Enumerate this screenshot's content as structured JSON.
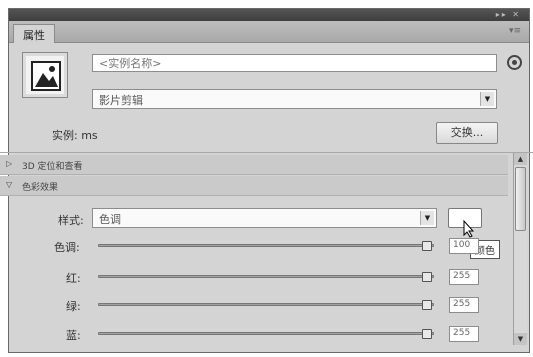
{
  "window": {
    "controls": "▸▸ ✕"
  },
  "tabs": [
    {
      "label": "属性"
    }
  ],
  "instance": {
    "name_placeholder": "<实例名称>",
    "type_value": "影片剪辑",
    "label": "实例: ",
    "symbol_name": "ms",
    "swap_label": "交换..."
  },
  "sections": [
    {
      "label": "3D 定位和查看",
      "expanded": false
    },
    {
      "label": "色彩效果",
      "expanded": true
    }
  ],
  "color_effect": {
    "style_label": "样式:",
    "style_value": "色调",
    "tooltip": "颜色",
    "swatch_color": "#ffffff",
    "rows": [
      {
        "label": "色调:",
        "value": "100",
        "level": 1.0
      },
      {
        "label": "红:",
        "value": "255",
        "level": 1.0
      },
      {
        "label": "绿:",
        "value": "255",
        "level": 1.0
      },
      {
        "label": "蓝:",
        "value": "255",
        "level": 1.0
      }
    ]
  },
  "colors": {
    "panel_bg": "#d4d4d4",
    "titlebar": "#3e3e3e",
    "section_bg": "#cacaca"
  }
}
